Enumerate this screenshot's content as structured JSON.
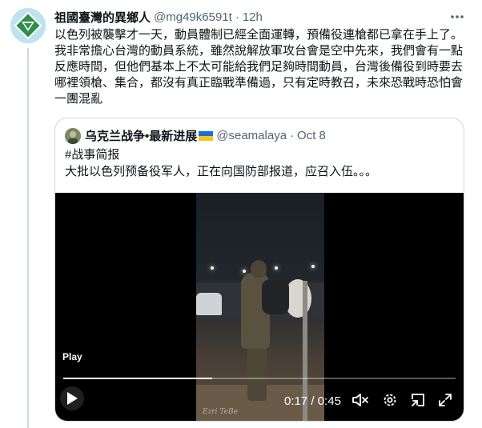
{
  "tweet": {
    "author_name": "祖國臺灣的異鄉人",
    "handle": "@mg49k6591t",
    "separator": "·",
    "time": "12h",
    "text": "以色列被襲擊才一天，動員體制已經全面運轉，預備役連槍都已拿在手上了。我非常擔心台灣的動員系統，雖然說解放軍攻台會是空中先來，我們會有一點反應時間，但他們基本上不太可能給我們足夠時間動員，台灣後備役到時要去哪裡領槍、集合，都沒有真正臨戰準備過，只有定時教召，未來恐戰時恐怕會一團混亂"
  },
  "quote": {
    "author_name": "乌克兰战争•最新进展",
    "handle": "@seamalaya",
    "separator": "·",
    "date": "Oct 8",
    "hashtag": "#战事简报",
    "text": "大批以色列预备役军人，正在向国防部报道，应召入伍。。。"
  },
  "video": {
    "play_label": "Play",
    "current_time": "0:17",
    "time_separator": " / ",
    "duration": "0:45",
    "progress": 0.38,
    "watermark": "Ezri TeBe"
  },
  "icons": {
    "more": "more-horizontal-icon",
    "play": "play-icon",
    "mute": "volume-muted-icon",
    "settings": "gear-icon",
    "picture_in_picture": "pip-icon",
    "fullscreen": "fullscreen-icon"
  },
  "colors": {
    "text": "#0f1419",
    "secondary_text": "#536471",
    "border": "#cfd9de",
    "video_bg": "#000000"
  }
}
